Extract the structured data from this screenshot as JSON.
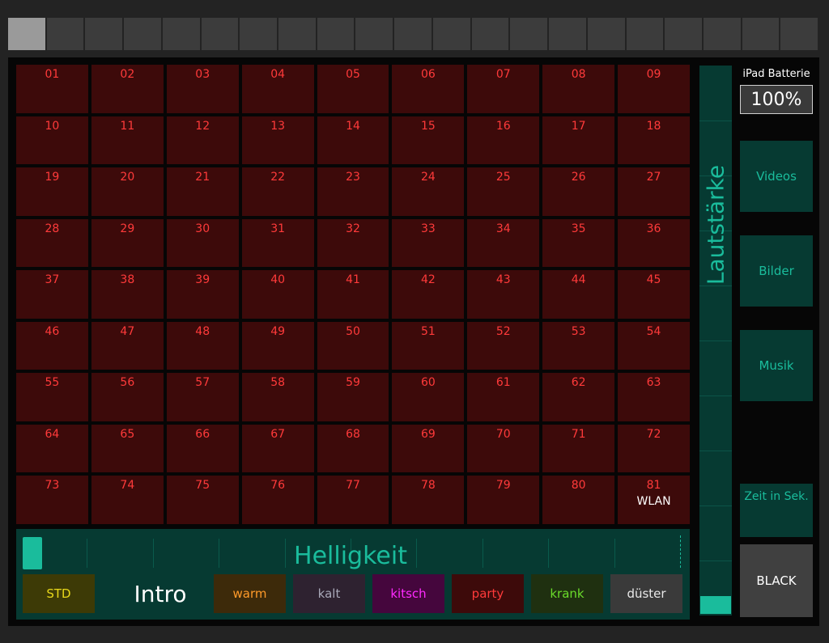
{
  "tabs": {
    "count": 21,
    "active_index": 0
  },
  "grid": {
    "cells": [
      "01",
      "02",
      "03",
      "04",
      "05",
      "06",
      "07",
      "08",
      "09",
      "10",
      "11",
      "12",
      "13",
      "14",
      "15",
      "16",
      "17",
      "18",
      "19",
      "20",
      "21",
      "22",
      "23",
      "24",
      "25",
      "26",
      "27",
      "28",
      "29",
      "30",
      "31",
      "32",
      "33",
      "34",
      "35",
      "36",
      "37",
      "38",
      "39",
      "40",
      "41",
      "42",
      "43",
      "44",
      "45",
      "46",
      "47",
      "48",
      "49",
      "50",
      "51",
      "52",
      "53",
      "54",
      "55",
      "56",
      "57",
      "58",
      "59",
      "60",
      "61",
      "62",
      "63",
      "64",
      "65",
      "66",
      "67",
      "68",
      "69",
      "70",
      "71",
      "72",
      "73",
      "74",
      "75",
      "76",
      "77",
      "78",
      "79",
      "80",
      "81"
    ],
    "last_cell_sub": "WLAN"
  },
  "brightness": {
    "label": "Helligkeit",
    "value": 0.0
  },
  "presets": [
    {
      "label": "STD",
      "bg": "#3d3a06",
      "fg": "#e8d81a"
    },
    {
      "label": "warm",
      "bg": "#3d2a0a",
      "fg": "#ff9a2a"
    },
    {
      "label": "kalt",
      "bg": "#2e2230",
      "fg": "#a8a8b8"
    },
    {
      "label": "kitsch",
      "bg": "#45063d",
      "fg": "#ff2aff"
    },
    {
      "label": "party",
      "bg": "#3d0a0a",
      "fg": "#ff3a3a"
    },
    {
      "label": "krank",
      "bg": "#1f3010",
      "fg": "#6adc2a"
    },
    {
      "label": "düster",
      "bg": "#3a3a3a",
      "fg": "#e8e8e8"
    }
  ],
  "intro_label": "Intro",
  "volume": {
    "label": "Lautstärke",
    "value": 0.0
  },
  "battery": {
    "title": "iPad Batterie",
    "value": "100%"
  },
  "side_buttons": {
    "videos": "Videos",
    "bilder": "Bilder",
    "musik": "Musik"
  },
  "zeit_label": "Zeit in Sek.",
  "black_label": "BLACK",
  "colors": {
    "accent": "#1abc9c",
    "cell_bg": "#3d0a0a",
    "cell_text": "#ff3a3a",
    "panel_teal": "#063a32"
  }
}
